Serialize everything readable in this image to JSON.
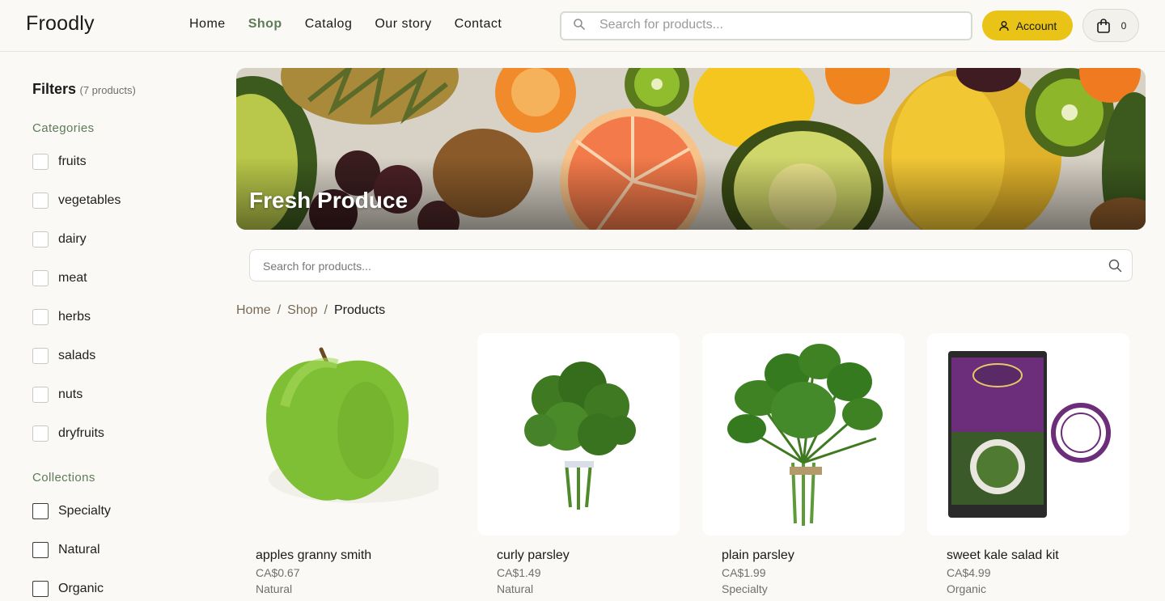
{
  "header": {
    "logo": "Froodly",
    "nav": [
      {
        "label": "Home",
        "active": false
      },
      {
        "label": "Shop",
        "active": true
      },
      {
        "label": "Catalog",
        "active": false
      },
      {
        "label": "Our story",
        "active": false
      },
      {
        "label": "Contact",
        "active": false
      }
    ],
    "search_placeholder": "Search for products...",
    "account_label": "Account",
    "cart_count": "0",
    "accent_color": "#e9c315",
    "active_nav_color": "#5f7a58"
  },
  "sidebar": {
    "title": "Filters",
    "count": "(7 products)",
    "categories_title": "Categories",
    "categories": [
      "fruits",
      "vegetables",
      "dairy",
      "meat",
      "herbs",
      "salads",
      "nuts",
      "dryfruits"
    ],
    "collections_title": "Collections",
    "collections": [
      "Specialty",
      "Natural",
      "Organic"
    ]
  },
  "hero": {
    "title": "Fresh Produce"
  },
  "main": {
    "search_placeholder": "Search for products...",
    "breadcrumb": {
      "home": "Home",
      "shop": "Shop",
      "current": "Products"
    },
    "products": [
      {
        "name": "apples granny smith",
        "price": "CA$0.67",
        "collection": "Natural",
        "icon": "green-apple"
      },
      {
        "name": "curly parsley",
        "price": "CA$1.49",
        "collection": "Natural",
        "icon": "curly-parsley-bunch"
      },
      {
        "name": "plain parsley",
        "price": "CA$1.99",
        "collection": "Specialty",
        "icon": "flat-parsley-bunch"
      },
      {
        "name": "sweet kale salad kit",
        "price": "CA$4.99",
        "collection": "Organic",
        "icon": "salad-kit-bag"
      }
    ]
  }
}
